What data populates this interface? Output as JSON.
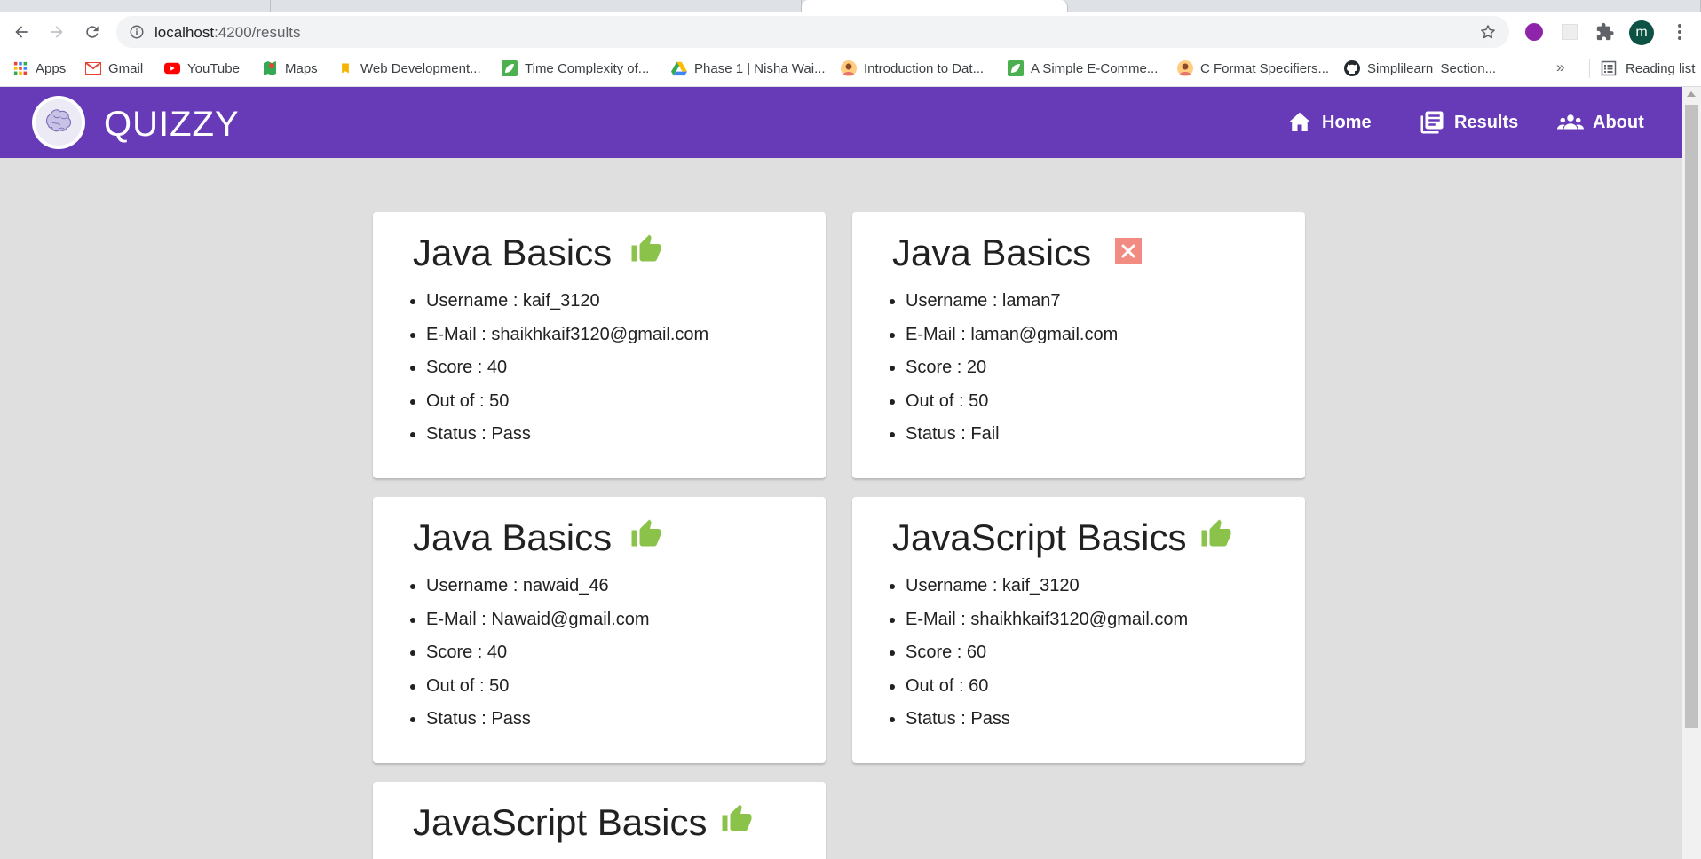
{
  "browser": {
    "url_host": "localhost",
    "url_path": ":4200/results",
    "profile_initial": "m",
    "bookmarks": [
      {
        "label": "Apps",
        "icon": "apps-grid-icon",
        "color": "#4285f4"
      },
      {
        "label": "Gmail",
        "icon": "gmail-icon",
        "color": "#ea4335"
      },
      {
        "label": "YouTube",
        "icon": "youtube-icon",
        "color": "#ff0000"
      },
      {
        "label": "Maps",
        "icon": "maps-icon",
        "color": "#34a853"
      },
      {
        "label": "Web Development...",
        "icon": "bookmark-favicon-icon",
        "color": "#f4b400"
      },
      {
        "label": "Time Complexity of...",
        "icon": "leaf-favicon-icon",
        "color": "#4caf50"
      },
      {
        "label": "Phase 1 | Nisha Wai...",
        "icon": "drive-icon",
        "color": "#fbbc04"
      },
      {
        "label": "Introduction to Dat...",
        "icon": "avatar-favicon-icon",
        "color": "#e57373"
      },
      {
        "label": "A Simple E-Comme...",
        "icon": "leaf-favicon-icon",
        "color": "#4caf50"
      },
      {
        "label": "C Format Specifiers...",
        "icon": "avatar-favicon-icon",
        "color": "#e57373"
      },
      {
        "label": "Simplilearn_Section...",
        "icon": "github-icon",
        "color": "#24292e"
      }
    ],
    "more_bookmarks": "»",
    "reading_list": "Reading list"
  },
  "app": {
    "brand": "QUIZZY",
    "accent": "#673ab7",
    "nav": [
      {
        "label": "Home",
        "icon": "home-icon"
      },
      {
        "label": "Results",
        "icon": "results-icon"
      },
      {
        "label": "About",
        "icon": "people-icon"
      }
    ]
  },
  "results": [
    {
      "title": "Java Basics",
      "status_icon": "thumbs-up-icon",
      "username": "Username : kaif_3120",
      "email": "E-Mail : shaikhkaif3120@gmail.com",
      "score": "Score : 40",
      "out_of": "Out of : 50",
      "status": "Status : Pass"
    },
    {
      "title": "Java Basics",
      "status_icon": "close-icon",
      "username": "Username : laman7",
      "email": "E-Mail : laman@gmail.com",
      "score": "Score : 20",
      "out_of": "Out of : 50",
      "status": "Status : Fail"
    },
    {
      "title": "Java Basics",
      "status_icon": "thumbs-up-icon",
      "username": "Username : nawaid_46",
      "email": "E-Mail : Nawaid@gmail.com",
      "score": "Score : 40",
      "out_of": "Out of : 50",
      "status": "Status : Pass"
    },
    {
      "title": "JavaScript Basics",
      "status_icon": "thumbs-up-icon",
      "username": "Username : kaif_3120",
      "email": "E-Mail : shaikhkaif3120@gmail.com",
      "score": "Score : 60",
      "out_of": "Out of : 60",
      "status": "Status : Pass"
    },
    {
      "title": "JavaScript Basics",
      "status_icon": "thumbs-up-icon"
    }
  ],
  "colors": {
    "pass": "#8bc34a",
    "fail": "#f28b82"
  }
}
